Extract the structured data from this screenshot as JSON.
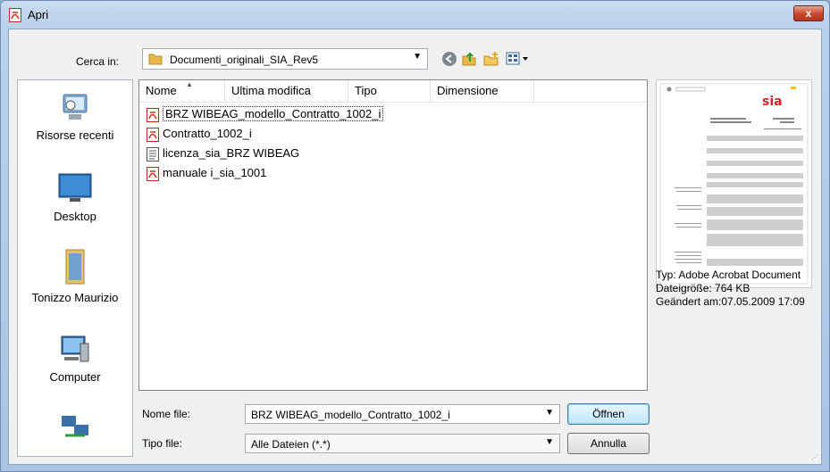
{
  "window": {
    "title": "Apri",
    "close_label": "x"
  },
  "lookin": {
    "label": "Cerca in:",
    "folder": "Documenti_originali_SIA_Rev5"
  },
  "places": [
    {
      "label": "Risorse recenti",
      "icon": "recent-places-icon"
    },
    {
      "label": "Desktop",
      "icon": "desktop-icon"
    },
    {
      "label": "Tonizzo Maurizio",
      "icon": "user-folder-icon"
    },
    {
      "label": "Computer",
      "icon": "computer-icon"
    },
    {
      "label": "",
      "icon": "network-icon"
    }
  ],
  "filelist": {
    "columns": [
      "Nome",
      "Ultima modifica",
      "Tipo",
      "Dimensione"
    ],
    "files": [
      {
        "name": "BRZ WIBEAG_modello_Contratto_1002_i",
        "icon": "pdf-icon",
        "selected": true
      },
      {
        "name": "Contratto_1002_i",
        "icon": "pdf-icon",
        "selected": false
      },
      {
        "name": "licenza_sia_BRZ WIBEAG",
        "icon": "document-icon",
        "selected": false
      },
      {
        "name": "manuale i_sia_1001",
        "icon": "pdf-icon",
        "selected": false
      }
    ]
  },
  "preview": {
    "logo": "sia",
    "type_line": "Typ: Adobe Acrobat Document",
    "size_line": "Dateigröße: 764 KB",
    "modified_line": "Geändert am:07.05.2009 17:09"
  },
  "bottom": {
    "filename_label": "Nome file:",
    "filename_value": "BRZ WIBEAG_modello_Contratto_1002_i",
    "filetype_label": "Tipo file:",
    "filetype_value": "Alle Dateien (*.*)",
    "open_label": "Öffnen",
    "cancel_label": "Annulla"
  },
  "colors": {
    "pdf_red": "#d42b1e",
    "title_bar": "#b9d1ea",
    "close_red": "#c7462d"
  }
}
